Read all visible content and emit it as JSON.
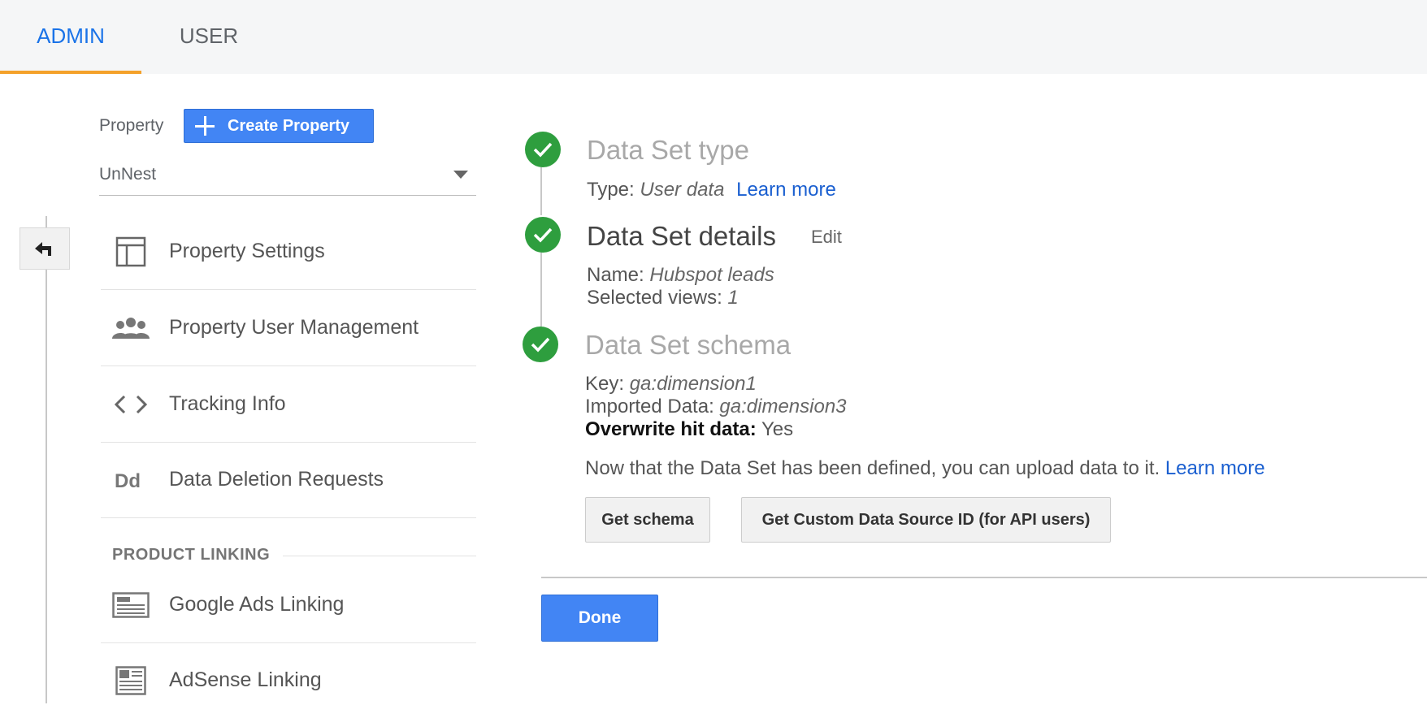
{
  "tabs": {
    "admin": "ADMIN",
    "user": "USER"
  },
  "property": {
    "label": "Property",
    "create_button": "Create Property",
    "selected": "UnNest"
  },
  "nav": {
    "items": [
      {
        "label": "Property Settings",
        "icon": "layout-icon"
      },
      {
        "label": "Property User Management",
        "icon": "people-icon"
      },
      {
        "label": "Tracking Info",
        "icon": "code-icon"
      },
      {
        "label": "Data Deletion Requests",
        "icon": "dd-icon"
      }
    ],
    "section_heading": "PRODUCT LINKING",
    "linking_items": [
      {
        "label": "Google Ads Linking",
        "icon": "ads-icon"
      },
      {
        "label": "AdSense Linking",
        "icon": "adsense-icon"
      }
    ]
  },
  "steps": {
    "type": {
      "title": "Data Set type",
      "type_label": "Type:",
      "type_value": "User data",
      "learn_more": "Learn more"
    },
    "details": {
      "title": "Data Set details",
      "edit": "Edit",
      "name_label": "Name:",
      "name_value": "Hubspot leads",
      "views_label": "Selected views:",
      "views_value": "1"
    },
    "schema": {
      "title": "Data Set schema",
      "key_label": "Key:",
      "key_value": "ga:dimension1",
      "imported_label": "Imported Data:",
      "imported_value": "ga:dimension3",
      "overwrite_label": "Overwrite hit data:",
      "overwrite_value": "Yes",
      "info_text": "Now that the Data Set has been defined, you can upload data to it.",
      "learn_more": "Learn more",
      "get_schema": "Get schema",
      "get_source_id": "Get Custom Data Source ID (for API users)"
    }
  },
  "done_button": "Done",
  "colors": {
    "accent": "#1a73e8",
    "tab_underline": "#f4a12a",
    "check": "#2e9e3e",
    "primary_button": "#4285f4"
  }
}
